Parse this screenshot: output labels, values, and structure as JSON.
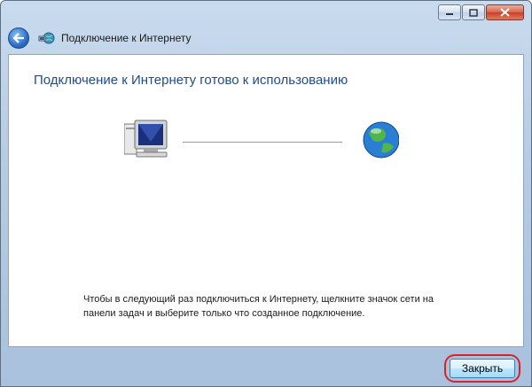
{
  "window": {
    "title": "Подключение к Интернету",
    "caption_buttons": {
      "minimize_icon": "minimize-icon",
      "maximize_icon": "maximize-icon",
      "close_icon": "close-icon"
    },
    "back_icon": "back-arrow-icon",
    "app_icon": "network-connection-icon"
  },
  "main": {
    "heading": "Подключение к Интернету готово к использованию",
    "diagram": {
      "left_icon": "computer-icon",
      "right_icon": "globe-icon"
    },
    "info_line1": "Чтобы в следующий раз подключиться к Интернету, щелкните значок сети на",
    "info_line2": "панели задач и выберите только что созданное подключение."
  },
  "footer": {
    "close_label": "Закрыть",
    "highlight_color": "#d4242c"
  },
  "colors": {
    "heading": "#1f4b8f",
    "titlebar": "#b6cce4"
  }
}
